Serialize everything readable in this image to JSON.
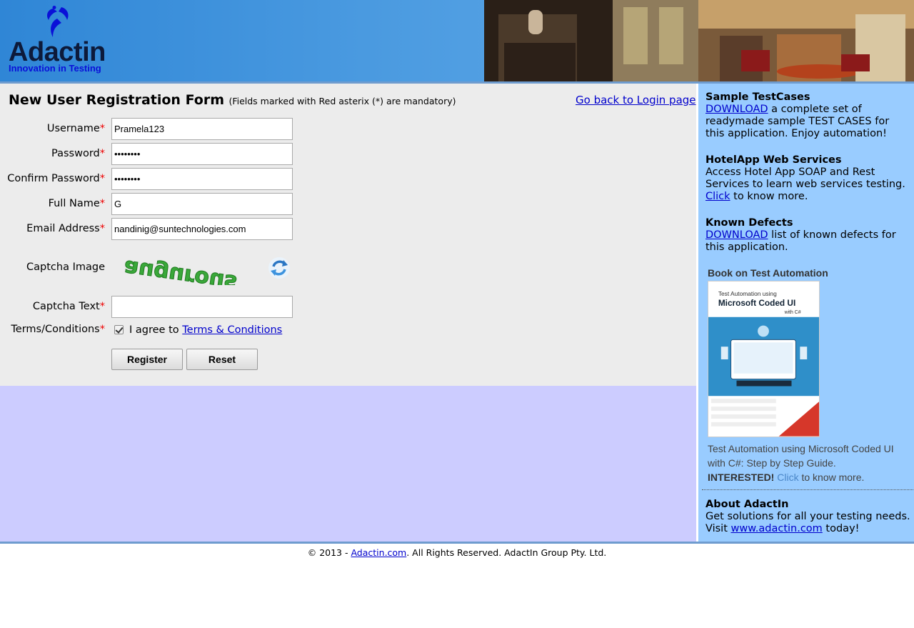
{
  "brand": {
    "name": "Adactin",
    "tagline": "Innovation in Testing"
  },
  "form": {
    "title": "New User Registration Form",
    "note": "(Fields marked with Red asterix (*) are mandatory)",
    "back_link": "Go back to Login page",
    "required_mark": "*",
    "fields": {
      "username": {
        "label": "Username",
        "value": "Pramela123"
      },
      "password": {
        "label": "Password",
        "value": "••••••••"
      },
      "confirm_password": {
        "label": "Confirm Password",
        "value": "••••••••"
      },
      "full_name": {
        "label": "Full Name",
        "value": "G"
      },
      "email": {
        "label": "Email Address",
        "value": "nandinig@suntechnologies.com"
      },
      "captcha_image": {
        "label": "Captcha Image",
        "captcha_word": "augurous"
      },
      "captcha_text": {
        "label": "Captcha Text",
        "value": ""
      },
      "terms": {
        "label": "Terms/Conditions",
        "checked": true,
        "agree_text": "I agree to ",
        "link": "Terms & Conditions"
      }
    },
    "buttons": {
      "register": "Register",
      "reset": "Reset"
    }
  },
  "sidebar": {
    "sample_testcases": {
      "title": "Sample TestCases",
      "link": "DOWNLOAD",
      "text": " a complete set of readymade sample TEST CASES for this application. Enjoy automation!"
    },
    "web_services": {
      "title": "HotelApp Web Services",
      "text": "Access Hotel App SOAP and Rest Services to learn web services testing. ",
      "link": "Click",
      "text_after": " to know more."
    },
    "known_defects": {
      "title": "Known Defects",
      "link": "DOWNLOAD",
      "text": " list of known defects for this application."
    },
    "book": {
      "heading": "Book on Test Automation",
      "cover_line1": "Test Automation using",
      "cover_line2": "Microsoft Coded UI",
      "cover_line3": "with C#",
      "desc": "Test Automation using Microsoft Coded UI with C#: Step by Step Guide.",
      "interested": "INTERESTED!",
      "link": "Click",
      "after": " to know more."
    },
    "about": {
      "title": "About AdactIn",
      "text": "Get solutions for all your testing needs. Visit ",
      "link": "www.adactin.com",
      "after": " today!"
    }
  },
  "footer": {
    "prefix": "© 2013 - ",
    "link": "Adactin.com",
    "suffix": ". All Rights Reserved. AdactIn Group Pty. Ltd."
  },
  "colors": {
    "header_blue": "#2f86d6",
    "sidebar_blue": "#99ccff",
    "lower_panel": "#ccccff",
    "form_panel": "#ececec",
    "required": "#ee0000"
  }
}
